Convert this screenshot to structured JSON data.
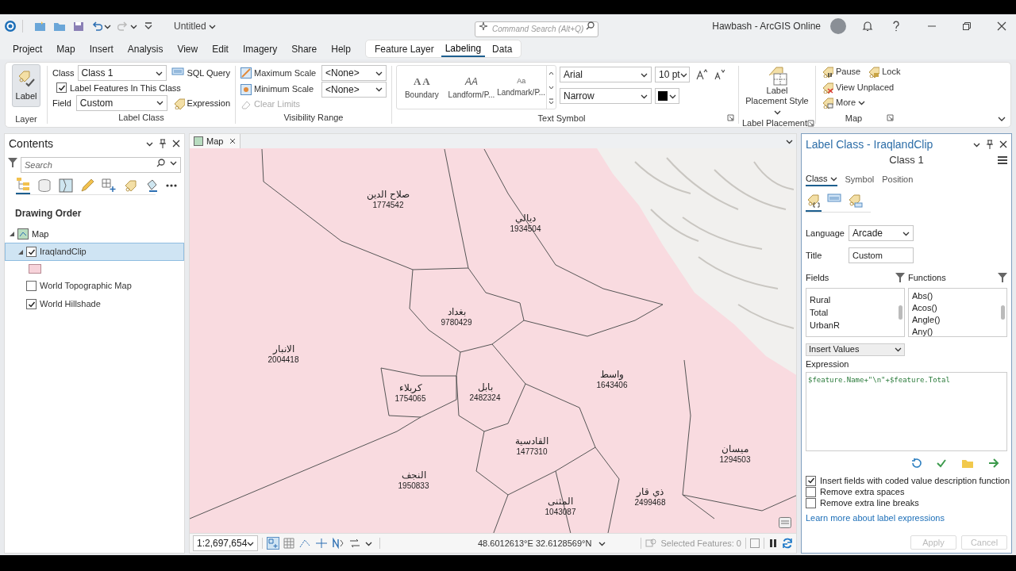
{
  "title_bar": {
    "document_title": "Untitled",
    "command_search": {
      "placeholder": "Command Search (Alt+Q)"
    },
    "user": "Hawbash - ArcGIS Online"
  },
  "menu_tabs": [
    {
      "label": "Project",
      "selected": false
    },
    {
      "label": "Map",
      "selected": false
    },
    {
      "label": "Insert",
      "selected": false
    },
    {
      "label": "Analysis",
      "selected": false
    },
    {
      "label": "View",
      "selected": false
    },
    {
      "label": "Edit",
      "selected": false
    },
    {
      "label": "Imagery",
      "selected": false
    },
    {
      "label": "Share",
      "selected": false
    },
    {
      "label": "Help",
      "selected": false
    }
  ],
  "contextual_tabs": [
    {
      "label": "Feature Layer",
      "selected": false
    },
    {
      "label": "Labeling",
      "selected": true
    },
    {
      "label": "Data",
      "selected": false
    }
  ],
  "ribbon": {
    "layer_group": {
      "label_button": "Label",
      "title": "Layer"
    },
    "label_class_group": {
      "class_label": "Class",
      "class_value": "Class 1",
      "sql_query": "SQL Query",
      "label_features": {
        "label": "Label Features In This Class",
        "checked": true
      },
      "field_label": "Field",
      "field_value": "Custom",
      "expression": "Expression",
      "title": "Label Class"
    },
    "visibility_group": {
      "maximum_scale": "Maximum Scale",
      "maximum_value": "<None>",
      "minimum_scale": "Minimum Scale",
      "minimum_value": "<None>",
      "clear_limits": {
        "label": "Clear Limits",
        "disabled": true
      },
      "title": "Visibility Range"
    },
    "text_symbol_group": {
      "styles": [
        {
          "preview": "A A",
          "name": "Boundary"
        },
        {
          "preview": "AA",
          "name": "Landform/P..."
        },
        {
          "preview": "Aa",
          "name": "Landmark/P..."
        }
      ],
      "font": "Arial",
      "size": "10 pt",
      "font_style": "Narrow",
      "color": "#000000",
      "title": "Text Symbol"
    },
    "label_placement_group": {
      "button": "Label Placement Style",
      "title": "Label Placement"
    },
    "map_group": {
      "pause": "Pause",
      "lock": "Lock",
      "view_unplaced": "View Unplaced",
      "more": "More",
      "title": "Map"
    }
  },
  "contents": {
    "title": "Contents",
    "search": {
      "placeholder": "Search"
    },
    "heading": "Drawing Order",
    "tree": [
      {
        "label": "Map",
        "expanded": true,
        "children": [
          {
            "label": "IraqlandClip",
            "checked": true,
            "selected": true,
            "expanded": true
          },
          {
            "label": "World Topographic Map",
            "checked": false,
            "selected": false,
            "expanded": false
          },
          {
            "label": "World Hillshade",
            "checked": true,
            "selected": false,
            "expanded": false
          }
        ]
      }
    ]
  },
  "map_view": {
    "tab": "Map",
    "labels": [
      {
        "name": "صلاح الدين",
        "value": "1774542"
      },
      {
        "name": "ديالي",
        "value": "1934504"
      },
      {
        "name": "بغداد",
        "value": "9780429"
      },
      {
        "name": "الانبار",
        "value": "2004418"
      },
      {
        "name": "واسط",
        "value": "1643406"
      },
      {
        "name": "بابل",
        "value": "2482324"
      },
      {
        "name": "كربلاء",
        "value": "1754065"
      },
      {
        "name": "القادسية",
        "value": "1477310"
      },
      {
        "name": "ميسان",
        "value": "1294503"
      },
      {
        "name": "النجف",
        "value": "1950833"
      },
      {
        "name": "ذي قار",
        "value": "2499468"
      },
      {
        "name": "المثنى",
        "value": "1043087"
      }
    ],
    "scale": "1:2,697,654",
    "coordinates": "48.6012613°E 32.6128569°N",
    "selected_features": "Selected Features: 0"
  },
  "label_class_pane": {
    "title": "Label Class - IraqlandClip",
    "class_name": "Class 1",
    "tabs": [
      {
        "label": "Class",
        "selected": true
      },
      {
        "label": "Symbol",
        "selected": false
      },
      {
        "label": "Position",
        "selected": false
      }
    ],
    "icon_tabs": [
      {
        "selected": true
      },
      {
        "selected": false
      },
      {
        "selected": false
      }
    ],
    "language_label": "Language",
    "language": "Arcade",
    "title_label": "Title",
    "title_value": "Custom",
    "fields_label": "Fields",
    "fields": [
      "Rural",
      "Total",
      "UrbanR"
    ],
    "functions_label": "Functions",
    "functions": [
      "Abs()",
      "Acos()",
      "Angle()",
      "Any()"
    ],
    "insert_values": "Insert Values",
    "expression_label": "Expression",
    "expression": "$feature.Name+\"\\n\"+$feature.Total",
    "options": [
      {
        "label": "Insert fields with coded value description function",
        "checked": true
      },
      {
        "label": "Remove extra spaces",
        "checked": false
      },
      {
        "label": "Remove extra line breaks",
        "checked": false
      }
    ],
    "learn_more": "Learn more about label expressions",
    "buttons": [
      {
        "label": "Apply",
        "disabled": true
      },
      {
        "label": "Cancel",
        "disabled": true
      }
    ]
  }
}
